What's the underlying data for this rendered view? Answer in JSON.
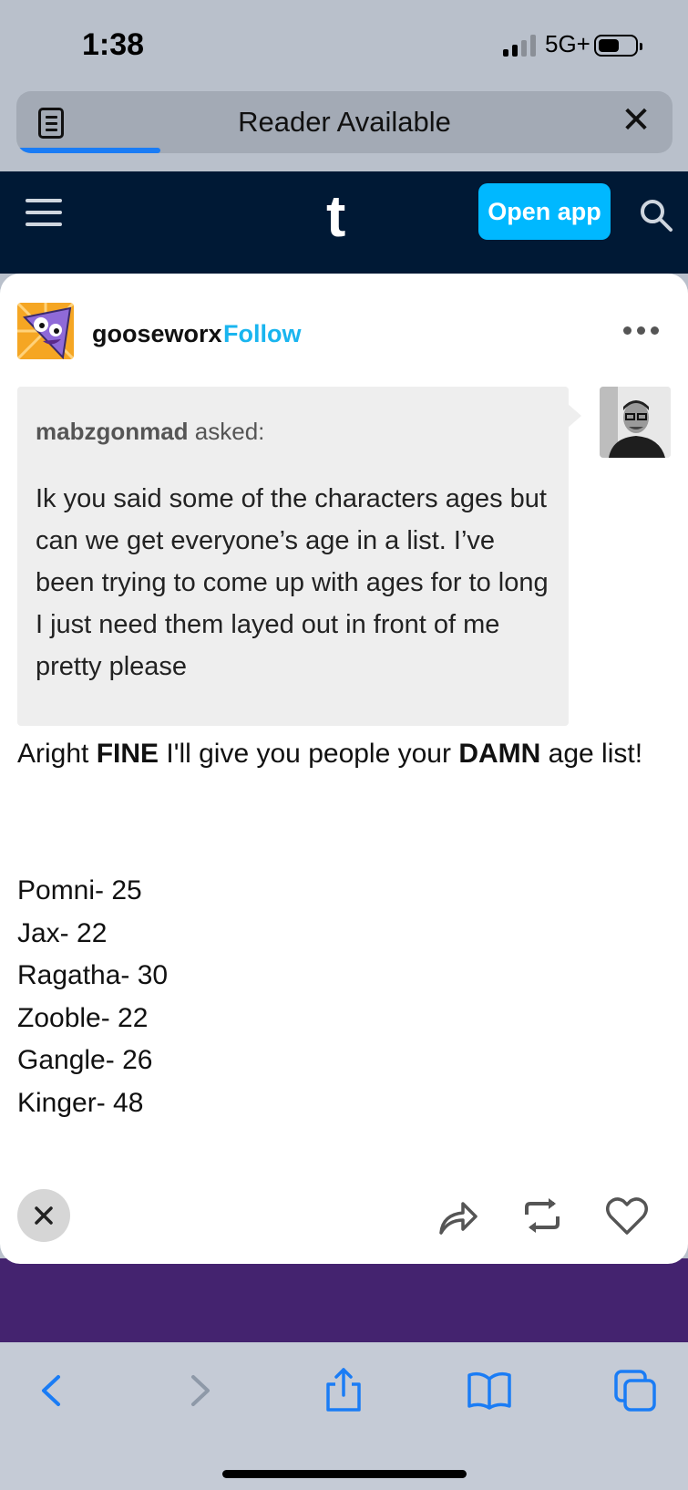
{
  "status_bar": {
    "time": "1:38",
    "network": "5G+"
  },
  "reader_bar": {
    "label": "Reader Available",
    "progress": 0.22
  },
  "header": {
    "open_app_label": "Open app",
    "logo": "t"
  },
  "post": {
    "username": "gooseworx",
    "follow_label": "Follow",
    "ask": {
      "asker": "mabzgonmad",
      "asked_label": " asked:",
      "question": "Ik you said some of the characters ages but can we get everyone’s age in a list. I’ve been trying to come up with ages for to long I just need them layed out in front of me pretty please"
    },
    "answer": {
      "part1": "Aright ",
      "bold1": "FINE",
      "part2": " I'll give you people your ",
      "bold2": "DAMN",
      "part3": " age list!"
    },
    "ages": [
      "Pomni- 25",
      "Jax- 22",
      "Ragatha- 30",
      "Zooble- 22",
      "Gangle- 26",
      "Kinger- 48"
    ]
  },
  "icons": {
    "reader": "reader-icon",
    "close": "close-icon",
    "menu": "hamburger-icon",
    "search": "search-icon",
    "more": "more-icon",
    "share": "share-icon",
    "reblog": "reblog-icon",
    "like": "heart-icon",
    "back": "back-icon",
    "forward": "forward-icon",
    "safari_share": "share-icon",
    "bookmarks": "book-icon",
    "tabs": "tabs-icon"
  },
  "colors": {
    "tumblr_navy": "#001935",
    "accent_blue": "#00b8ff",
    "follow_blue": "#19b5ef",
    "safari_blue": "#1a7cf5",
    "purple": "#44236f"
  }
}
